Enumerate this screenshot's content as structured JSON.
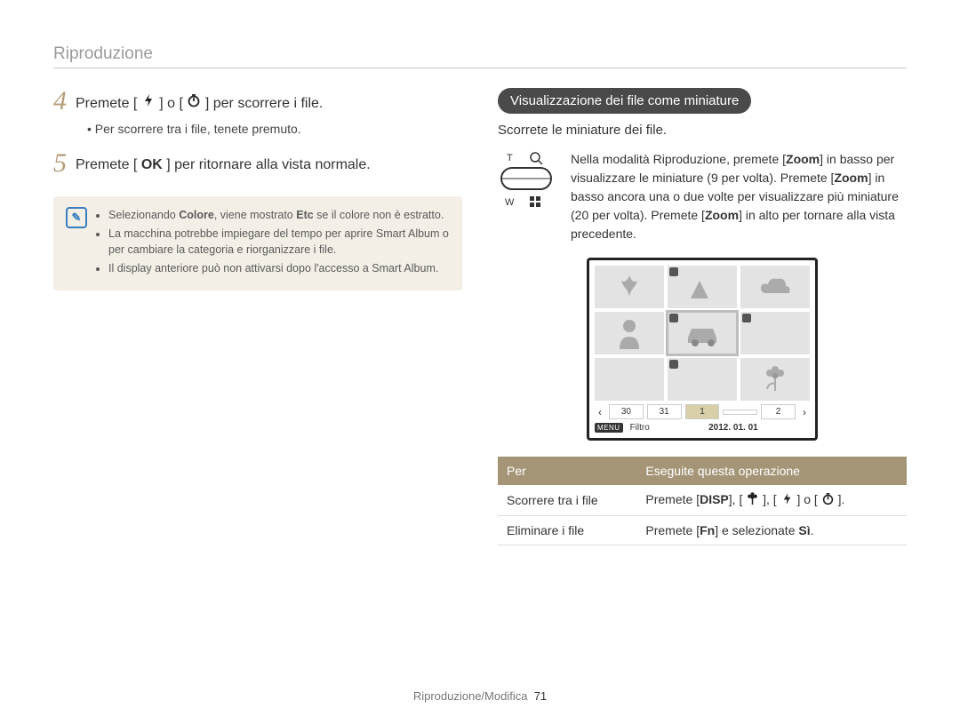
{
  "header": "Riproduzione",
  "left": {
    "step4_pre": "Premete [",
    "step4_mid": "] o [",
    "step4_post": "] per scorrere i file.",
    "step4_sub": "• Per scorrere tra i file, tenete premuto.",
    "step5_pre": "Premete [",
    "step5_ok": "OK",
    "step5_post": "] per ritornare alla vista normale.",
    "note1": "Selezionando Colore, viene mostrato Etc se il colore non è estratto.",
    "note2": "La macchina potrebbe impiegare del tempo per aprire Smart Album o per cambiare la categoria e riorganizzare i file.",
    "note3": "Il display anteriore può non attivarsi dopo l'accesso a Smart Album."
  },
  "right": {
    "pill": "Visualizzazione dei file come miniature",
    "intro": "Scorrete le miniature dei file.",
    "zoom_T": "T",
    "zoom_W": "W",
    "zoom_para_1": "Nella modalità Riproduzione, premete [",
    "zoom_para_2": "] in basso per visualizzare le miniature (9 per volta). Premete [",
    "zoom_para_3": "] in basso ancora una o due volte per visualizzare più miniature (20 per volta). Premete [",
    "zoom_para_4": "] in alto per tornare alla vista precedente.",
    "zoom_kw": "Zoom",
    "dates": [
      "30",
      "31",
      "1",
      "2"
    ],
    "filter_label": "Filtro",
    "date_text": "2012. 01. 01",
    "table": {
      "h1": "Per",
      "h2": "Eseguite questa operazione",
      "r1c1": "Scorrere tra i file",
      "r1_pre": "Premete [",
      "r1_disp": "DISP",
      "r1_sep": "], [",
      "r1_mid": "], [",
      "r1_or": "] o [",
      "r1_post": "].",
      "r2c1": "Eliminare i file",
      "r2_pre": "Premete [",
      "r2_fn": "Fn",
      "r2_post": "] e selezionate ",
      "r2_si": "Sì",
      "r2_dot": "."
    }
  },
  "footer": {
    "text": "Riproduzione/Modifica",
    "page": "71"
  }
}
